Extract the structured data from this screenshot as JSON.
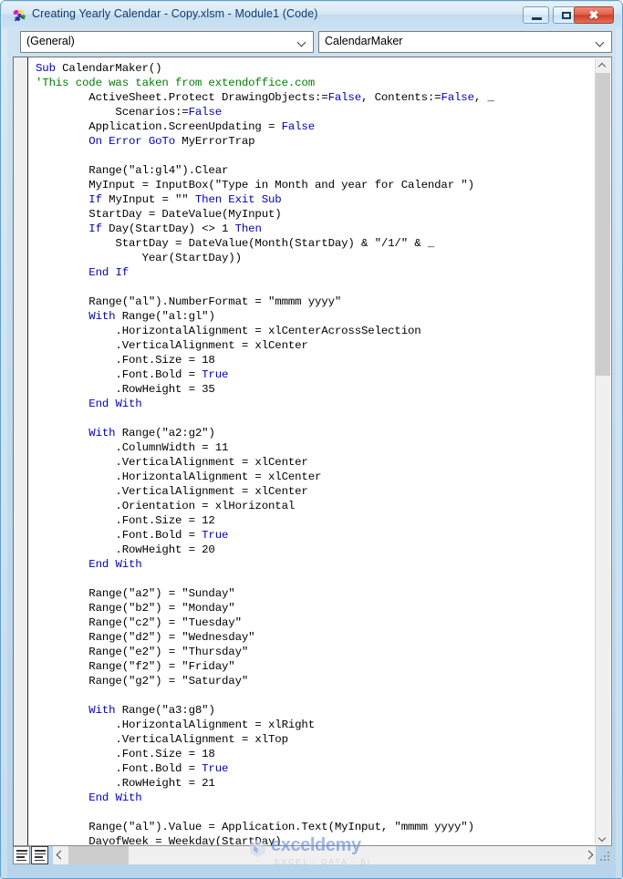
{
  "window": {
    "title": "Creating Yearly Calendar - Copy.xlsm - Module1 (Code)",
    "app_icon": "vba-module-icon",
    "controls": {
      "minimize_label": "",
      "maximize_label": "",
      "close_label": "✖"
    }
  },
  "toolbar": {
    "object_combo": {
      "value": "(General)",
      "icon": "chevron-down-icon"
    },
    "procedure_combo": {
      "value": "CalendarMaker",
      "icon": "chevron-down-icon"
    }
  },
  "editor": {
    "lines": [
      [
        {
          "t": "Sub",
          "c": "kw"
        },
        {
          "t": " CalendarMaker()",
          "c": ""
        }
      ],
      [
        {
          "t": "'This code was taken from extendoffice.com",
          "c": "cmt"
        }
      ],
      [
        {
          "t": "        ActiveSheet.Protect DrawingObjects:=",
          "c": ""
        },
        {
          "t": "False",
          "c": "kw"
        },
        {
          "t": ", Contents:=",
          "c": ""
        },
        {
          "t": "False",
          "c": "kw"
        },
        {
          "t": ", _",
          "c": ""
        }
      ],
      [
        {
          "t": "            Scenarios:=",
          "c": ""
        },
        {
          "t": "False",
          "c": "kw"
        }
      ],
      [
        {
          "t": "        Application.ScreenUpdating = ",
          "c": ""
        },
        {
          "t": "False",
          "c": "kw"
        }
      ],
      [
        {
          "t": "        ",
          "c": ""
        },
        {
          "t": "On Error GoTo",
          "c": "kw"
        },
        {
          "t": " MyErrorTrap",
          "c": ""
        }
      ],
      [
        {
          "t": "",
          "c": ""
        }
      ],
      [
        {
          "t": "        Range(\"al:gl4\").Clear",
          "c": ""
        }
      ],
      [
        {
          "t": "        MyInput = InputBox(\"Type in Month and year for Calendar \")",
          "c": ""
        }
      ],
      [
        {
          "t": "        ",
          "c": ""
        },
        {
          "t": "If",
          "c": "kw"
        },
        {
          "t": " MyInput = \"\" ",
          "c": ""
        },
        {
          "t": "Then Exit Sub",
          "c": "kw"
        }
      ],
      [
        {
          "t": "        StartDay = DateValue(MyInput)",
          "c": ""
        }
      ],
      [
        {
          "t": "        ",
          "c": ""
        },
        {
          "t": "If",
          "c": "kw"
        },
        {
          "t": " Day(StartDay) <> 1 ",
          "c": ""
        },
        {
          "t": "Then",
          "c": "kw"
        }
      ],
      [
        {
          "t": "            StartDay = DateValue(Month(StartDay) & \"/1/\" & _",
          "c": ""
        }
      ],
      [
        {
          "t": "                Year(StartDay))",
          "c": ""
        }
      ],
      [
        {
          "t": "        ",
          "c": ""
        },
        {
          "t": "End If",
          "c": "kw"
        }
      ],
      [
        {
          "t": "",
          "c": ""
        }
      ],
      [
        {
          "t": "        Range(\"al\").NumberFormat = \"mmmm yyyy\"",
          "c": ""
        }
      ],
      [
        {
          "t": "        ",
          "c": ""
        },
        {
          "t": "With",
          "c": "kw"
        },
        {
          "t": " Range(\"al:gl\")",
          "c": ""
        }
      ],
      [
        {
          "t": "            .HorizontalAlignment = xlCenterAcrossSelection",
          "c": ""
        }
      ],
      [
        {
          "t": "            .VerticalAlignment = xlCenter",
          "c": ""
        }
      ],
      [
        {
          "t": "            .Font.Size = 18",
          "c": ""
        }
      ],
      [
        {
          "t": "            .Font.Bold = ",
          "c": ""
        },
        {
          "t": "True",
          "c": "kw"
        }
      ],
      [
        {
          "t": "            .RowHeight = 35",
          "c": ""
        }
      ],
      [
        {
          "t": "        ",
          "c": ""
        },
        {
          "t": "End With",
          "c": "kw"
        }
      ],
      [
        {
          "t": "",
          "c": ""
        }
      ],
      [
        {
          "t": "        ",
          "c": ""
        },
        {
          "t": "With",
          "c": "kw"
        },
        {
          "t": " Range(\"a2:g2\")",
          "c": ""
        }
      ],
      [
        {
          "t": "            .ColumnWidth = 11",
          "c": ""
        }
      ],
      [
        {
          "t": "            .VerticalAlignment = xlCenter",
          "c": ""
        }
      ],
      [
        {
          "t": "            .HorizontalAlignment = xlCenter",
          "c": ""
        }
      ],
      [
        {
          "t": "            .VerticalAlignment = xlCenter",
          "c": ""
        }
      ],
      [
        {
          "t": "            .Orientation = xlHorizontal",
          "c": ""
        }
      ],
      [
        {
          "t": "            .Font.Size = 12",
          "c": ""
        }
      ],
      [
        {
          "t": "            .Font.Bold = ",
          "c": ""
        },
        {
          "t": "True",
          "c": "kw"
        }
      ],
      [
        {
          "t": "            .RowHeight = 20",
          "c": ""
        }
      ],
      [
        {
          "t": "        ",
          "c": ""
        },
        {
          "t": "End With",
          "c": "kw"
        }
      ],
      [
        {
          "t": "",
          "c": ""
        }
      ],
      [
        {
          "t": "        Range(\"a2\") = \"Sunday\"",
          "c": ""
        }
      ],
      [
        {
          "t": "        Range(\"b2\") = \"Monday\"",
          "c": ""
        }
      ],
      [
        {
          "t": "        Range(\"c2\") = \"Tuesday\"",
          "c": ""
        }
      ],
      [
        {
          "t": "        Range(\"d2\") = \"Wednesday\"",
          "c": ""
        }
      ],
      [
        {
          "t": "        Range(\"e2\") = \"Thursday\"",
          "c": ""
        }
      ],
      [
        {
          "t": "        Range(\"f2\") = \"Friday\"",
          "c": ""
        }
      ],
      [
        {
          "t": "        Range(\"g2\") = \"Saturday\"",
          "c": ""
        }
      ],
      [
        {
          "t": "",
          "c": ""
        }
      ],
      [
        {
          "t": "        ",
          "c": ""
        },
        {
          "t": "With",
          "c": "kw"
        },
        {
          "t": " Range(\"a3:g8\")",
          "c": ""
        }
      ],
      [
        {
          "t": "            .HorizontalAlignment = xlRight",
          "c": ""
        }
      ],
      [
        {
          "t": "            .VerticalAlignment = xlTop",
          "c": ""
        }
      ],
      [
        {
          "t": "            .Font.Size = 18",
          "c": ""
        }
      ],
      [
        {
          "t": "            .Font.Bold = ",
          "c": ""
        },
        {
          "t": "True",
          "c": "kw"
        }
      ],
      [
        {
          "t": "            .RowHeight = 21",
          "c": ""
        }
      ],
      [
        {
          "t": "        ",
          "c": ""
        },
        {
          "t": "End With",
          "c": "kw"
        }
      ],
      [
        {
          "t": "",
          "c": ""
        }
      ],
      [
        {
          "t": "        Range(\"al\").Value = Application.Text(MyInput, \"mmmm yyyy\")",
          "c": ""
        }
      ],
      [
        {
          "t": "        DayofWeek = Weekday(StartDay)",
          "c": ""
        }
      ]
    ],
    "colors": {
      "keyword": "#0000C0",
      "comment": "#008000",
      "text": "#000000",
      "background": "#FFFFFF"
    }
  },
  "scrollbars": {
    "vertical": {
      "up_icon": "chevron-up-icon",
      "down_icon": "chevron-down-icon"
    },
    "horizontal": {
      "left_icon": "chevron-left-icon",
      "right_icon": "chevron-right-icon"
    }
  },
  "view_buttons": {
    "procedure_view": "procedure-view",
    "full_module_view": "full-module-view"
  },
  "watermark": {
    "name": "exceldemy",
    "tagline": "EXCEL · DATA · BI"
  }
}
